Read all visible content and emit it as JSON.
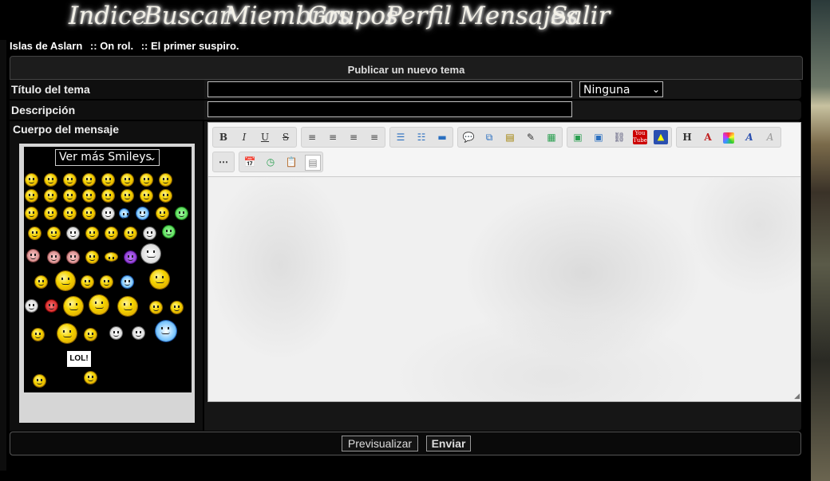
{
  "nav": {
    "items": [
      {
        "label": "Indice"
      },
      {
        "label": "Buscar"
      },
      {
        "label": "Miembros"
      },
      {
        "label": "Grupos"
      },
      {
        "label": "Perfil"
      },
      {
        "label": "Mensajes"
      },
      {
        "label": "Salir"
      }
    ]
  },
  "breadcrumb": {
    "items": [
      "Islas de Aslarn",
      ":: On rol.",
      ":: El primer suspiro."
    ]
  },
  "form": {
    "header": "Publicar un nuevo tema",
    "title_label": "Título del tema",
    "title_value": "",
    "icon_select": "Ninguna",
    "description_label": "Descripción",
    "description_value": "",
    "body_label": "Cuerpo del mensaje"
  },
  "smileys": {
    "more_select": "Ver más Smileys",
    "lol_sign": "LOL!"
  },
  "editor": {
    "toolbar_row1": [
      {
        "group": "text-format",
        "buttons": [
          "B",
          "I",
          "U",
          "S"
        ]
      },
      {
        "group": "align",
        "buttons": [
          "align-left",
          "align-center",
          "align-right",
          "align-justify"
        ]
      },
      {
        "group": "lists",
        "buttons": [
          "bullet-list",
          "numbered-list",
          "horizontal-rule"
        ]
      },
      {
        "group": "quote",
        "buttons": [
          "quote",
          "code",
          "spoiler",
          "hide",
          "table"
        ]
      },
      {
        "group": "media",
        "buttons": [
          "image",
          "host-image",
          "link",
          "youtube",
          "flash"
        ]
      },
      {
        "group": "font",
        "buttons": [
          "H",
          "font-size",
          "color",
          "font-face",
          "remove-format"
        ]
      }
    ],
    "toolbar_row2": [
      "more",
      "date",
      "time",
      "paste",
      "source"
    ],
    "content": ""
  },
  "buttons": {
    "preview": "Previsualizar",
    "submit": "Enviar"
  },
  "colors": {
    "background": "#000000",
    "panel": "#161616",
    "editor": "#f5f5f5",
    "smiley_panel": "#d6d6d6"
  }
}
